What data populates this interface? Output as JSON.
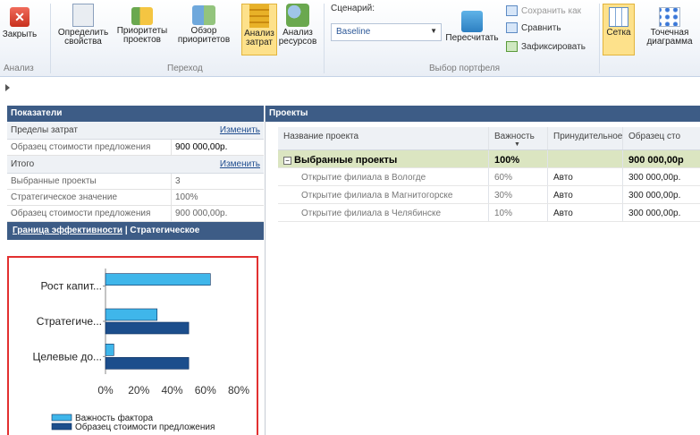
{
  "ribbon": {
    "close_label": "Закрыть",
    "define_label": "Определить свойства",
    "priorities_label": "Приоритеты проектов",
    "review_label": "Обзор приоритетов",
    "cost_analysis_label": "Анализ затрат",
    "resource_analysis_label": "Анализ ресурсов",
    "scenario_label": "Сценарий:",
    "scenario_value": "Baseline",
    "recalc_label": "Пересчитать",
    "save_as_label": "Сохранить как",
    "compare_label": "Сравнить",
    "commit_label": "Зафиксировать",
    "grid_label": "Сетка",
    "scatter_label": "Точечная диаграмма",
    "group_analysis": "Анализ",
    "group_navigate": "Переход",
    "group_portfolio": "Выбор портфеля"
  },
  "left": {
    "header": "Показатели",
    "cost_limits": "Пределы затрат",
    "edit1": "Изменить",
    "row_sample": "Образец стоимости предложения",
    "row_sample_value": "900 000,00р.",
    "total": "Итого",
    "edit2": "Изменить",
    "selected_projects": "Выбранные проекты",
    "selected_projects_value": "3",
    "strategic_value": "Стратегическое значение",
    "strategic_value_value": "100%",
    "sample2": "Образец стоимости предложения",
    "sample2_value": "900 000,00р.",
    "tab_frontier": "Граница эффективности",
    "tab_sep": "|",
    "tab_strategic": "Стратегическое"
  },
  "right": {
    "header": "Проекты",
    "col_name": "Название проекта",
    "col_importance": "Важность",
    "col_forced": "Принудительное",
    "col_sample": "Образец сто",
    "group_name": "Выбранные проекты",
    "group_importance": "100%",
    "group_sample": "900 000,00р",
    "rows": [
      {
        "name": "Открытие филиала в Вологде",
        "importance": "60%",
        "forced": "Авто",
        "sample": "300 000,00р."
      },
      {
        "name": "Открытие филиала в Магнитогорске",
        "importance": "30%",
        "forced": "Авто",
        "sample": "300 000,00р."
      },
      {
        "name": "Открытие филиала в Челябинске",
        "importance": "10%",
        "forced": "Авто",
        "sample": "300 000,00р."
      }
    ]
  },
  "chart_data": {
    "type": "bar",
    "orientation": "horizontal",
    "categories": [
      "Рост капит...",
      "Стратегиче...",
      "Целевые до..."
    ],
    "series": [
      {
        "name": "Важность фактора",
        "values": [
          0.63,
          0.31,
          0.05
        ],
        "color": "#3fb6ea"
      },
      {
        "name": "Образец стоимости предложения",
        "values": [
          null,
          0.5,
          0.5
        ],
        "color": "#1c4e8c"
      }
    ],
    "xticks": [
      "0%",
      "20%",
      "40%",
      "60%",
      "80%"
    ],
    "xlim": [
      0,
      0.8
    ],
    "legend": "bottom"
  },
  "colors": {
    "header_bg": "#3d5c86",
    "group_row": "#dbe5c1",
    "highlight_border": "#e23030",
    "active_button": "#fde18b"
  }
}
